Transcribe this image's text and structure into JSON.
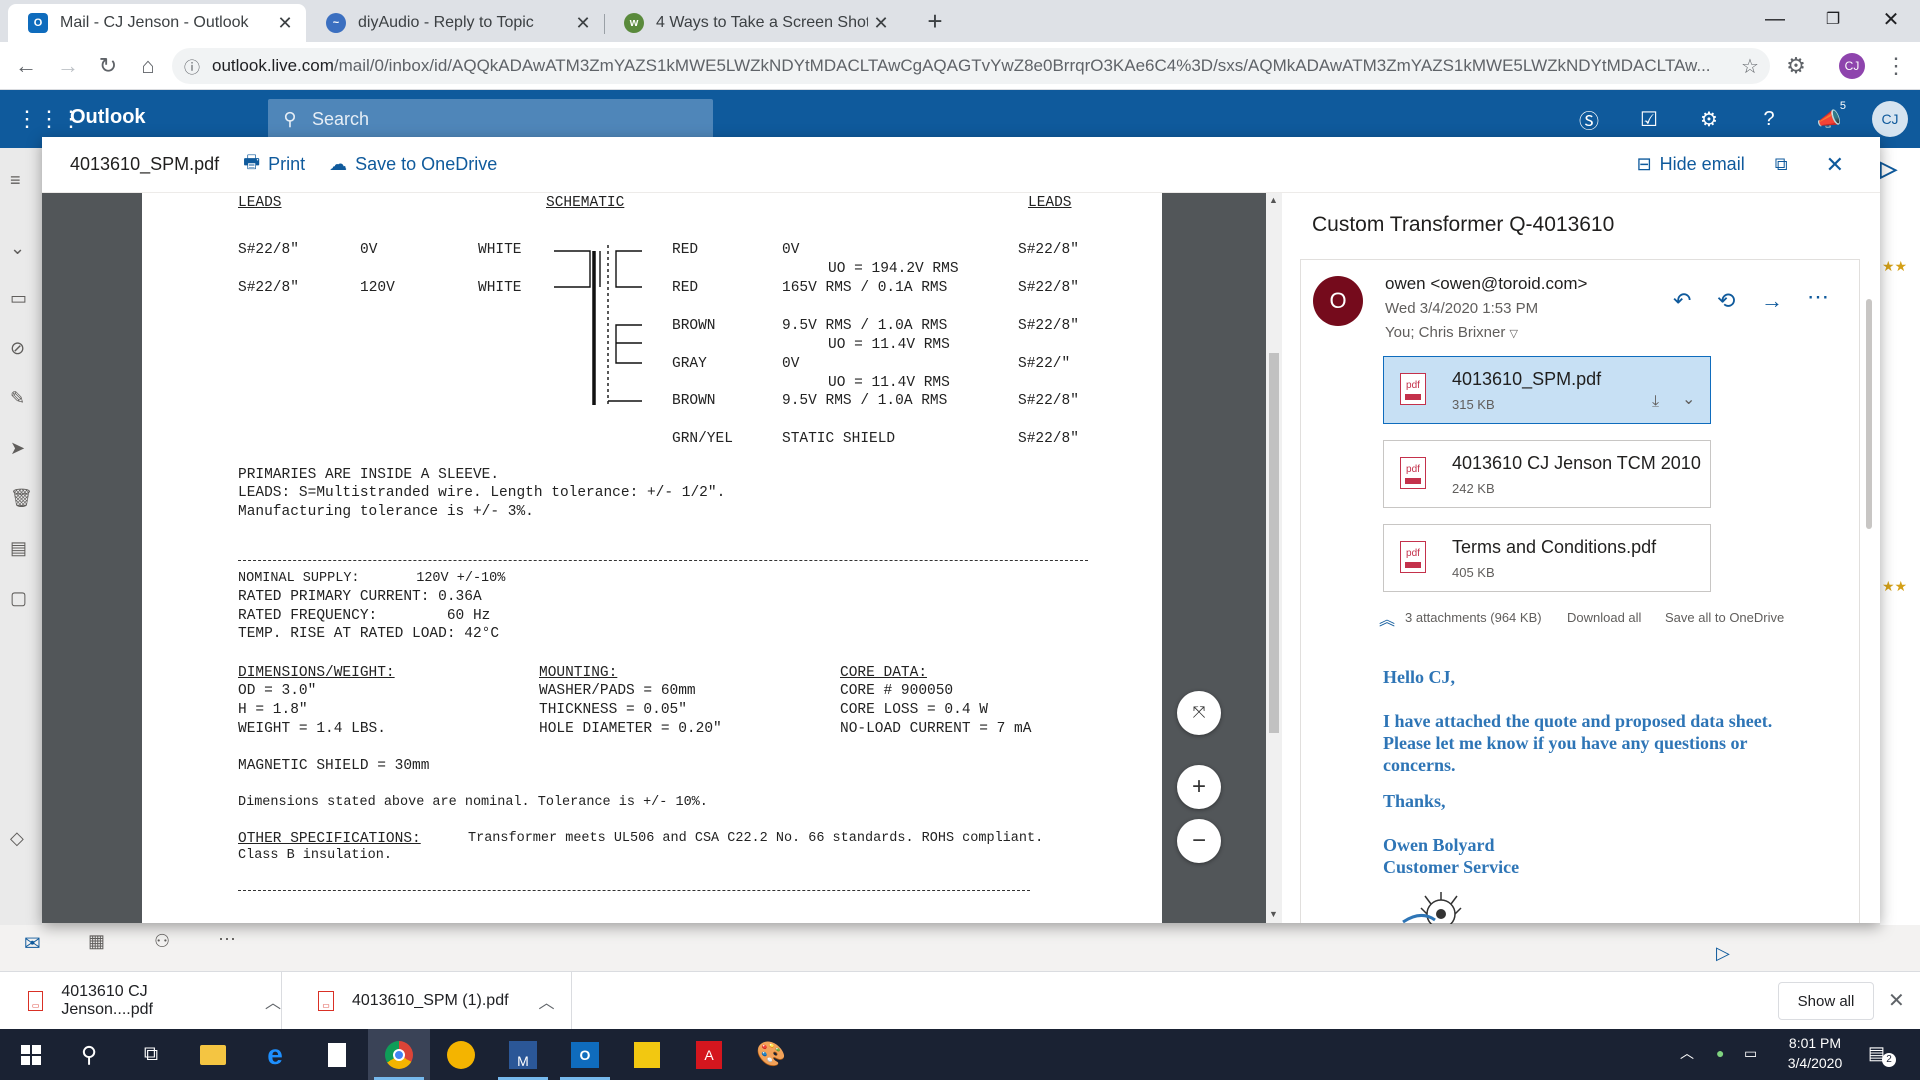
{
  "browser": {
    "tabs": [
      {
        "title": "Mail - CJ Jenson - Outlook",
        "icon": "outlook-icon",
        "active": true
      },
      {
        "title": "diyAudio - Reply to Topic",
        "icon": "diyaudio-icon",
        "active": false
      },
      {
        "title": "4 Ways to Take a Screen Shot (Sc",
        "icon": "wikihow-icon",
        "active": false
      }
    ],
    "url_host": "outlook.live.com",
    "url_path": "/mail/0/inbox/id/AQQkADAwATM3ZmYAZS1kMWE5LWZkNDYtMDACLTAwCgAQAGTvYwZ8e0BrrqrO3KAe6C4%3D/sxs/AQMkADAwATM3ZmYAZS1kMWE5LWZkNDYtMDACLTAw...",
    "profile_initials": "CJ"
  },
  "outlook": {
    "brand": "Outlook",
    "search_placeholder": "Search",
    "notification_count": "5",
    "user_initials": "CJ",
    "accent_color": "#0f5a9c"
  },
  "viewer": {
    "file_name": "4013610_SPM.pdf",
    "print_label": "Print",
    "save_onedrive_label": "Save to OneDrive",
    "hide_email_label": "Hide email"
  },
  "pdf": {
    "hdr_leads_left": "LEADS",
    "hdr_schematic": "SCHEMATIC",
    "hdr_leads_right": "LEADS",
    "primary_rows": [
      {
        "wire": "S#22/8\"",
        "voltage": "0V",
        "color": "WHITE"
      },
      {
        "wire": "S#22/8\"",
        "voltage": "120V",
        "color": "WHITE"
      }
    ],
    "secondary_rows": [
      {
        "color": "RED",
        "value": "0V",
        "wire": "S#22/8\""
      },
      {
        "color": "RED",
        "value": "165V RMS / 0.1A RMS",
        "wire": "S#22/8\""
      },
      {
        "color": "BROWN",
        "value": "9.5V RMS / 1.0A RMS",
        "wire": "S#22/8\""
      },
      {
        "color": "GRAY",
        "value": "0V",
        "wire": "S#22/\""
      },
      {
        "color": "BROWN",
        "value": "9.5V RMS / 1.0A RMS",
        "wire": "S#22/8\""
      },
      {
        "color": "GRN/YEL",
        "value": "STATIC SHIELD",
        "wire": "S#22/8\""
      }
    ],
    "uo_1": "UO = 194.2V RMS",
    "uo_2": "UO = 11.4V RMS",
    "uo_3": "UO = 11.4V RMS",
    "note_1": "PRIMARIES ARE INSIDE A SLEEVE.",
    "note_2": "LEADS: S=Multistranded wire. Length tolerance: +/- 1/2\".",
    "note_3": "Manufacturing tolerance is +/- 3%.",
    "supply_1": "NOMINAL SUPPLY:       120V +/-10%",
    "supply_2": "RATED PRIMARY CURRENT: 0.36A",
    "supply_3": "RATED FREQUENCY:        60 Hz",
    "supply_4": "TEMP. RISE AT RATED LOAD: 42°C",
    "dim_head": "DIMENSIONS/WEIGHT:",
    "dim_1": "OD = 3.0\"",
    "dim_2": "H = 1.8\"",
    "dim_3": "WEIGHT = 1.4 LBS.",
    "mount_head": "MOUNTING:",
    "mount_1": "WASHER/PADS = 60mm",
    "mount_2": "THICKNESS = 0.05\"",
    "mount_3": "HOLE DIAMETER = 0.20\"",
    "core_head": "CORE DATA:",
    "core_1": "CORE # 900050",
    "core_2": "CORE LOSS = 0.4 W",
    "core_3": "NO-LOAD CURRENT = 7 mA",
    "shield": "MAGNETIC SHIELD = 30mm",
    "dims_note": "Dimensions stated above are nominal. Tolerance is +/- 10%.",
    "other_head": "OTHER SPECIFICATIONS:",
    "other_text": "Transformer meets UL506 and CSA C22.2 No. 66 standards. ROHS compliant.",
    "class_text": "Class B insulation."
  },
  "email": {
    "subject": "Custom Transformer Q-4013610",
    "avatar_initial": "O",
    "sender": "owen <owen@toroid.com>",
    "date": "Wed 3/4/2020 1:53 PM",
    "recipients": "You; Chris Brixner",
    "attachments": [
      {
        "name": "4013610_SPM.pdf",
        "size": "315 KB"
      },
      {
        "name": "4013610 CJ Jenson TCM 2010...",
        "size": "242 KB"
      },
      {
        "name": "Terms and Conditions.pdf",
        "size": "405 KB"
      }
    ],
    "attachments_summary": "3 attachments (964 KB)",
    "download_all": "Download all",
    "save_all_onedrive": "Save all to OneDrive",
    "greeting": "Hello CJ,",
    "body": "I have attached the quote and proposed data sheet. Please let me know if you have any questions or concerns.",
    "thanks": "Thanks,",
    "sig_name": "Owen Bolyard",
    "sig_title": "Customer Service"
  },
  "downloads": {
    "items": [
      {
        "name": "4013610 CJ Jenson....pdf"
      },
      {
        "name": "4013610_SPM (1).pdf"
      }
    ],
    "show_all": "Show all"
  },
  "taskbar": {
    "time": "8:01 PM",
    "date": "3/4/2020",
    "notification_count": "2"
  }
}
